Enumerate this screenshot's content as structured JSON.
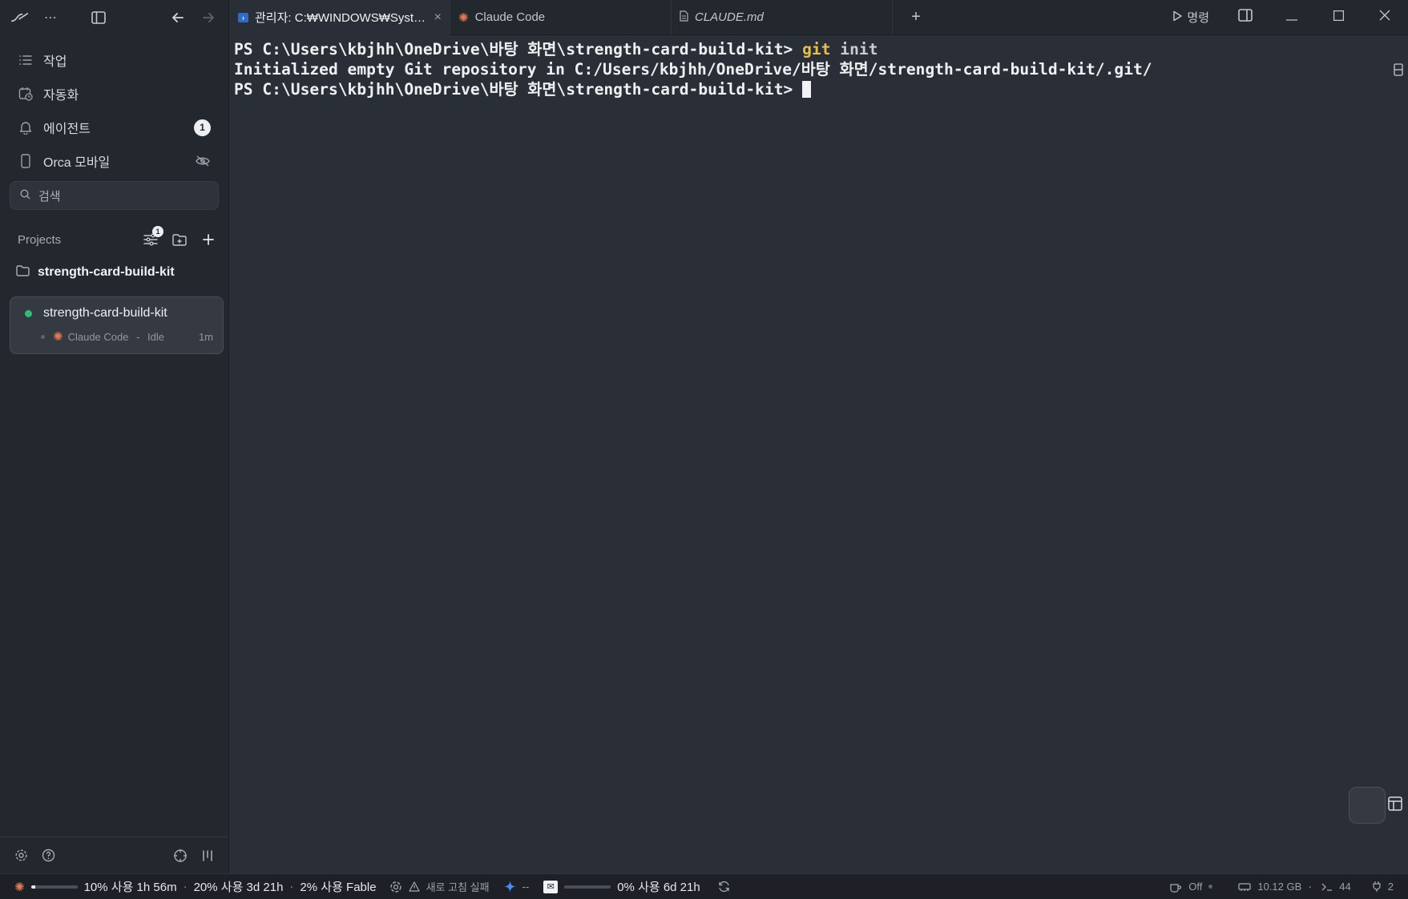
{
  "sidebar": {
    "nav": [
      {
        "label": "작업",
        "icon": "list-icon"
      },
      {
        "label": "자동화",
        "icon": "calendar-clock-icon"
      },
      {
        "label": "에이전트",
        "icon": "bell-icon",
        "badge": "1"
      },
      {
        "label": "Orca 모바일",
        "icon": "mobile-icon"
      }
    ],
    "search_placeholder": "검색",
    "projects": {
      "title": "Projects",
      "filter_badge": "1",
      "folder": "strength-card-build-kit",
      "worktree": {
        "name": "strength-card-build-kit",
        "session": "Claude Code",
        "session_sep": " - ",
        "status": "Idle",
        "time": "1m",
        "status_color": "#2fbf71"
      }
    }
  },
  "tabs": [
    {
      "label": "관리자: C:₩WINDOWS₩Syst…",
      "icon": "powershell-icon",
      "active": true
    },
    {
      "label": "Claude Code",
      "icon": "claude-icon"
    },
    {
      "label": "CLAUDE.md",
      "icon": "file-icon"
    }
  ],
  "toolbar": {
    "command_label": "명령"
  },
  "terminal": {
    "line1_prompt": "PS C:\\Users\\kbjhh\\OneDrive\\바탕 화면\\strength-card-build-kit> ",
    "line1_cmd": "git",
    "line1_arg": " init",
    "line2": "Initialized empty Git repository in C:/Users/kbjhh/OneDrive/바탕 화면/strength-card-build-kit/.git/",
    "line3_prompt": "PS C:\\Users\\kbjhh\\OneDrive\\바탕 화면\\strength-card-build-kit> "
  },
  "status": {
    "claude_session": {
      "text": "10% 사용 1h 56m",
      "progress": 0.1
    },
    "claude_week": "20% 사용 3d 21h",
    "fable": "2% 사용 Fable",
    "sep": "·",
    "openai_text": "새로 고침 실패",
    "gemini_text": "--",
    "mail": {
      "text": "0% 사용 6d 21h",
      "progress": 0.0
    },
    "sleep": "Off",
    "memory": "10.12 GB",
    "terminals": "44",
    "ports": "2"
  },
  "colors": {
    "accent_claude": "#e07a52",
    "git_cmd": "#e3c04d",
    "status_green": "#2fbf71"
  }
}
